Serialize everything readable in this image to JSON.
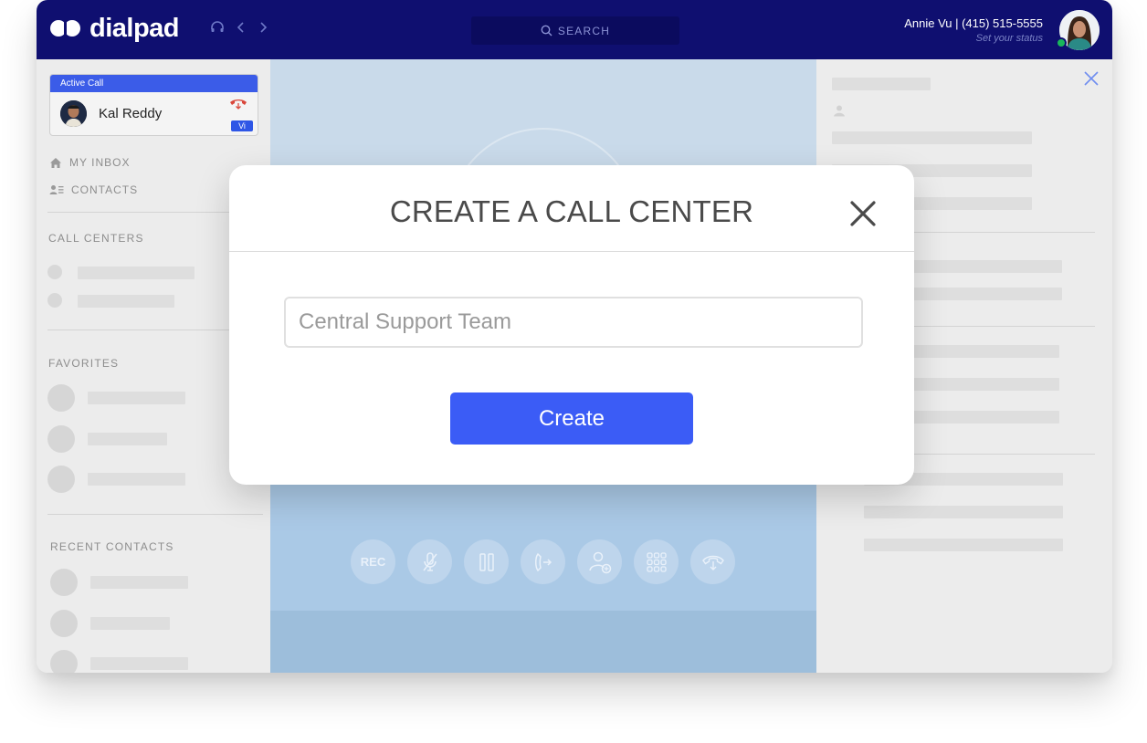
{
  "app": {
    "name": "dialpad",
    "brand_color": "#0f0f70",
    "accent_color": "#3b5cf6"
  },
  "header": {
    "search_label": "SEARCH",
    "user_name": "Annie Vu | (415) 515-5555",
    "status_prompt": "Set your status",
    "presence_color": "#19b65b",
    "nav_icons": [
      "headset-icon",
      "back-icon",
      "forward-icon"
    ]
  },
  "sidebar": {
    "active_call": {
      "header": "Active Call",
      "caller": "Kal Reddy",
      "badge": "Vi"
    },
    "nav": [
      {
        "label": "MY INBOX",
        "icon": "home-icon"
      },
      {
        "label": "CONTACTS",
        "icon": "contacts-icon"
      }
    ],
    "sections": {
      "call_centers": "CALL CENTERS",
      "favorites": "FAVORITES",
      "recent_contacts": "RECENT CONTACTS"
    }
  },
  "call_controls": [
    {
      "name": "record",
      "label": "REC"
    },
    {
      "name": "mute",
      "icon": "mic-off-icon"
    },
    {
      "name": "hold",
      "icon": "pause-icon"
    },
    {
      "name": "transfer",
      "icon": "transfer-icon"
    },
    {
      "name": "add-caller",
      "icon": "add-person-icon"
    },
    {
      "name": "keypad",
      "icon": "keypad-icon"
    },
    {
      "name": "hang-up",
      "icon": "hang-up-icon"
    }
  ],
  "modal": {
    "title": "CREATE A CALL CENTER",
    "input_value": "",
    "input_placeholder": "Central Support Team",
    "create_label": "Create"
  }
}
